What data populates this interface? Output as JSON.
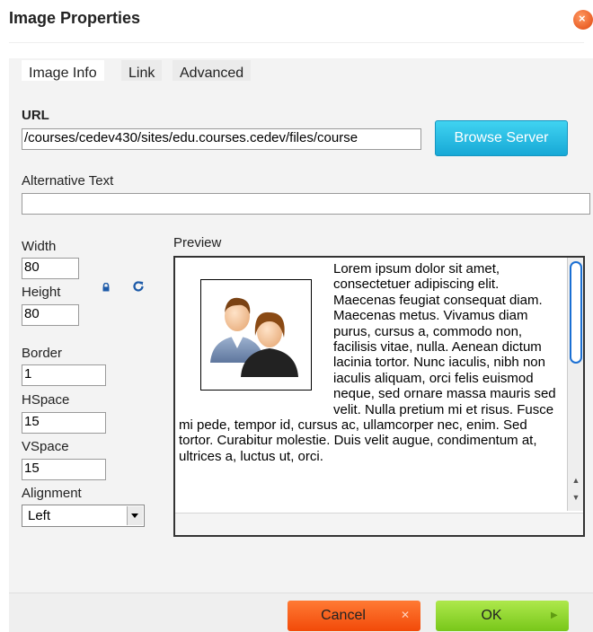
{
  "dialog": {
    "title": "Image Properties"
  },
  "tabs": [
    {
      "label": "Image Info",
      "active": true
    },
    {
      "label": "Link",
      "active": false
    },
    {
      "label": "Advanced",
      "active": false
    }
  ],
  "url": {
    "label": "URL",
    "value": "/courses/cedev430/sites/edu.courses.cedev/files/course"
  },
  "browse": {
    "label": "Browse Server"
  },
  "alt": {
    "label": "Alternative Text",
    "value": ""
  },
  "width": {
    "label": "Width",
    "value": "80"
  },
  "height": {
    "label": "Height",
    "value": "80"
  },
  "border": {
    "label": "Border",
    "value": "1"
  },
  "hspace": {
    "label": "HSpace",
    "value": "15"
  },
  "vspace": {
    "label": "VSpace",
    "value": "15"
  },
  "alignment": {
    "label": "Alignment",
    "value": "Left"
  },
  "preview": {
    "label": "Preview",
    "text": "Lorem ipsum dolor sit amet, consectetuer adipiscing elit. Maecenas feugiat consequat diam. Maecenas metus. Vivamus diam purus, cursus a, commodo non, facilisis vitae, nulla. Aenean dictum lacinia tortor. Nunc iaculis, nibh non iaculis aliquam, orci felis euismod neque, sed ornare massa mauris sed velit. Nulla pretium mi et risus. Fusce mi pede, tempor id, cursus ac, ullamcorper nec, enim. Sed tortor. Curabitur molestie. Duis velit augue, condimentum at, ultrices a, luctus ut, orci."
  },
  "footer": {
    "cancel_label": "Cancel",
    "ok_label": "OK"
  },
  "colors": {
    "browse": "#1fb4de",
    "cancel": "#f25a12",
    "ok": "#94d62f",
    "scroll_thumb": "#1a6fd3"
  },
  "icons": {
    "close": "close-icon",
    "lock": "lock-icon",
    "reset": "reset-size-icon",
    "dropdown": "chevron-down-icon",
    "cancel": "x-icon",
    "ok": "play-triangle-icon"
  }
}
